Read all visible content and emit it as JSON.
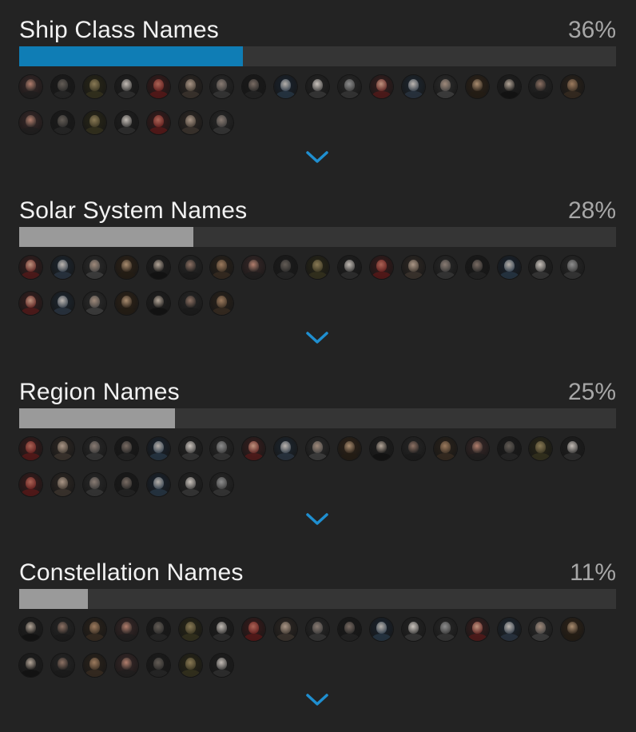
{
  "accent_color": "#0f7db5",
  "neutral_bar_color": "#9a9a9a",
  "sections": [
    {
      "title": "Ship Class Names",
      "percent_label": "36%",
      "fill_fraction": 0.36,
      "highlighted": true,
      "avatar_count": 25,
      "expand_icon": "chevron-down-icon"
    },
    {
      "title": "Solar System Names",
      "percent_label": "28%",
      "fill_fraction": 0.28,
      "highlighted": false,
      "avatar_count": 25,
      "expand_icon": "chevron-down-icon"
    },
    {
      "title": "Region Names",
      "percent_label": "25%",
      "fill_fraction": 0.25,
      "highlighted": false,
      "avatar_count": 25,
      "expand_icon": "chevron-down-icon"
    },
    {
      "title": "Constellation Names",
      "percent_label": "11%",
      "fill_fraction": 0.11,
      "highlighted": false,
      "avatar_count": 25,
      "expand_icon": "chevron-down-icon"
    }
  ]
}
